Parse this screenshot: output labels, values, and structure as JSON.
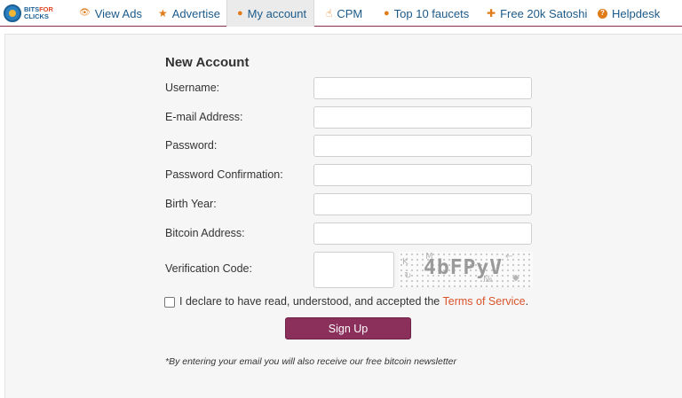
{
  "nav": {
    "logo": {
      "text_line1_a": "BITS",
      "text_line1_b": "FOR",
      "text_line2": "CLICKS"
    },
    "items": [
      {
        "label": "View Ads",
        "icon": "eye-icon",
        "glyph": "👁",
        "color": "#e07b1a"
      },
      {
        "label": "Advertise",
        "icon": "star-icon",
        "glyph": "★",
        "color": "#e07b1a"
      },
      {
        "label": "My account",
        "icon": "user-icon",
        "glyph": "👤",
        "color": "#e07b1a"
      },
      {
        "label": "CPM",
        "icon": "thumbs-up-icon",
        "glyph": "👍",
        "color": "#e07b1a"
      },
      {
        "label": "Top 10 faucets",
        "icon": "drop-icon",
        "glyph": "💧",
        "color": "#e07b1a"
      },
      {
        "label": "Free 20k Satoshi",
        "icon": "plus-circle-icon",
        "glyph": "✚",
        "color": "#e07b1a"
      },
      {
        "label": "Helpdesk",
        "icon": "question-circle-icon",
        "glyph": "?",
        "color": "#e07b1a"
      }
    ],
    "active_item": "My account"
  },
  "form": {
    "title": "New Account",
    "fields": [
      {
        "label": "Username:",
        "value": ""
      },
      {
        "label": "E-mail Address:",
        "value": ""
      },
      {
        "label": "Password:",
        "value": ""
      },
      {
        "label": "Password Confirmation:",
        "value": ""
      },
      {
        "label": "Birth Year:",
        "value": ""
      },
      {
        "label": "Bitcoin Address:",
        "value": ""
      },
      {
        "label": "Verification Code:",
        "value": ""
      }
    ],
    "captcha_text": "4bFPyV",
    "declare_text": "I declare to have read, understood, and accepted the ",
    "tos_link": "Terms of Service",
    "declare_end": ".",
    "signup_label": "Sign Up",
    "note": "*By entering your email you will also receive our free bitcoin newsletter"
  },
  "colors": {
    "accent": "#8b2f5b",
    "link": "#1c5a8a",
    "tos": "#d9532b",
    "icon": "#e07b1a"
  }
}
